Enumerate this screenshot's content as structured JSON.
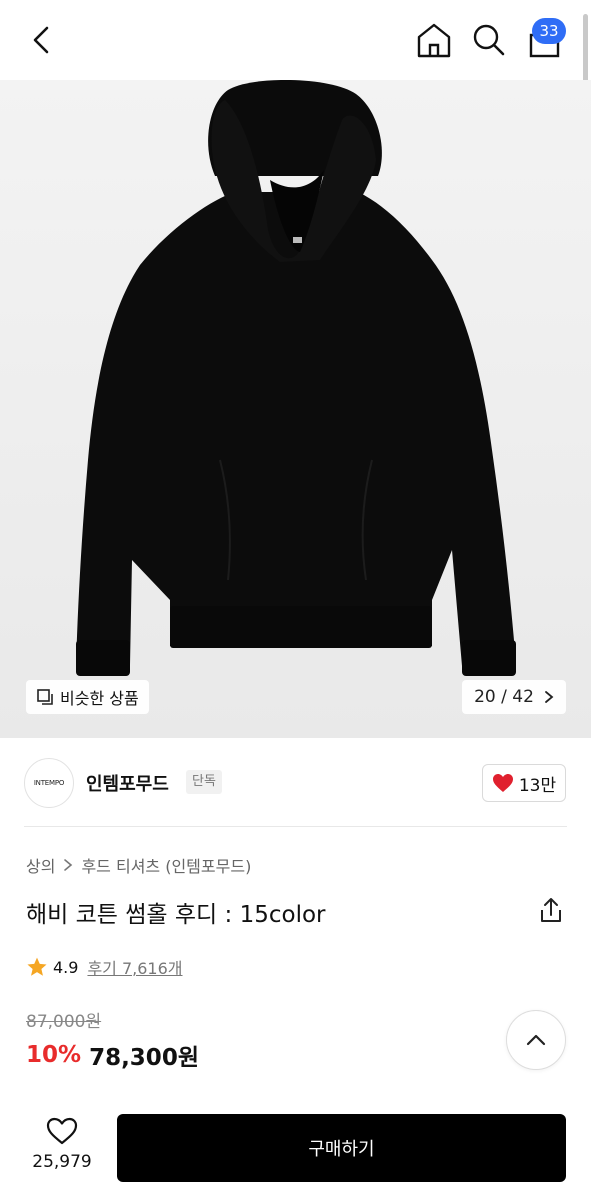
{
  "header": {
    "cart_count": "33"
  },
  "gallery": {
    "similar_label": "비슷한 상품",
    "counter": "20 / 42"
  },
  "brand": {
    "logo_text": "INTEMPO",
    "name": "인템포무드",
    "exclusive_label": "단독",
    "likes": "13만"
  },
  "product": {
    "breadcrumb": [
      "상의",
      "후드 티셔츠 (인템포무드)"
    ],
    "title": "해비 코튼 썸홀 후디 : 15color",
    "rating": "4.9",
    "reviews": "후기 7,616개",
    "original_price": "87,000원",
    "discount": "10%",
    "sale_price": "78,300원"
  },
  "bottom": {
    "wish_count": "25,979",
    "buy_label": "구매하기"
  },
  "colors": {
    "accent_blue": "#2f6df6",
    "discount_red": "#e82c2c",
    "heart_red": "#e0202e",
    "star": "#f5a623"
  }
}
